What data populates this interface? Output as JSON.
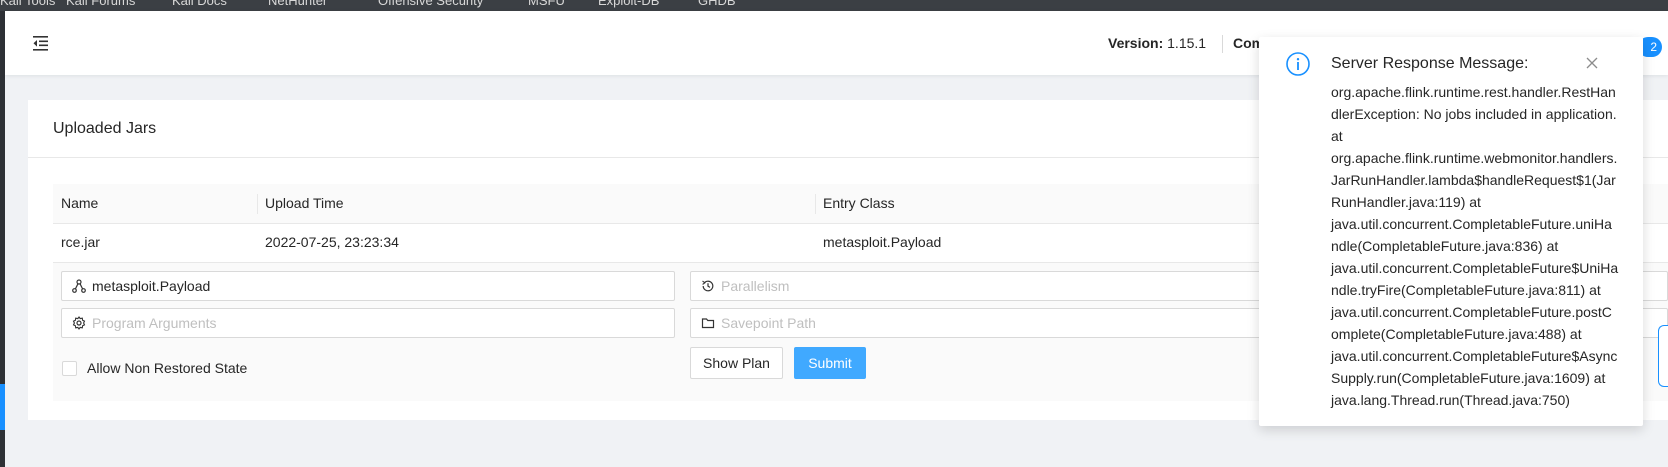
{
  "bookmarks": [
    "Kali Tools",
    "Kali Forums",
    "Kali Docs",
    "NetHunter",
    "Offensive Security",
    "MSFU",
    "Exploit-DB",
    "GHDB"
  ],
  "header": {
    "version_label": "Version:",
    "version_value": "1.15.1",
    "commit_label": "Com",
    "badge_count": "2"
  },
  "card": {
    "title": "Uploaded Jars",
    "columns": [
      "Name",
      "Upload Time",
      "Entry Class"
    ],
    "rows": [
      {
        "name": "rce.jar",
        "upload_time": "2022-07-25, 23:23:34",
        "entry_class": "metasploit.Payload"
      }
    ]
  },
  "form": {
    "entry_class_value": "metasploit.Payload",
    "parallelism_placeholder": "Parallelism",
    "program_args_placeholder": "Program Arguments",
    "savepoint_placeholder": "Savepoint Path",
    "allow_non_restored_label": "Allow Non Restored State",
    "show_plan_label": "Show Plan",
    "submit_label": "Submit"
  },
  "notification": {
    "title": "Server Response Message:",
    "lines": [
      "org.apache.flink.runtime.rest.handler.RestHan",
      "dlerException: No jobs included in application.",
      "at",
      "org.apache.flink.runtime.webmonitor.handlers.",
      "JarRunHandler.lambda$handleRequest$1(Jar",
      "RunHandler.java:119) at",
      "java.util.concurrent.CompletableFuture.uniHa",
      "ndle(CompletableFuture.java:836) at",
      "java.util.concurrent.CompletableFuture$UniHa",
      "ndle.tryFire(CompletableFuture.java:811) at",
      "java.util.concurrent.CompletableFuture.postC",
      "omplete(CompletableFuture.java:488) at",
      "java.util.concurrent.CompletableFuture$Async",
      "Supply.run(CompletableFuture.java:1609) at",
      "java.lang.Thread.run(Thread.java:750)"
    ]
  }
}
